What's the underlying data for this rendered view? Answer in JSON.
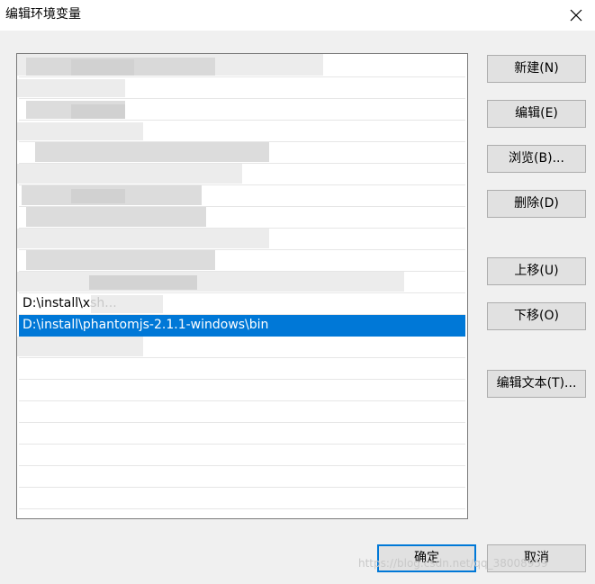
{
  "window": {
    "title": "编辑环境变量"
  },
  "list": {
    "items": [
      {
        "text": ""
      },
      {
        "text": ""
      },
      {
        "text": ""
      },
      {
        "text": ""
      },
      {
        "text": ""
      },
      {
        "text": ""
      },
      {
        "text": ""
      },
      {
        "text": ""
      },
      {
        "text": ""
      },
      {
        "text": ""
      },
      {
        "text": ""
      },
      {
        "text": "D:\\install\\xsh..."
      },
      {
        "text": "D:\\install\\phantomjs-2.1.1-windows\\bin"
      },
      {
        "text": ""
      }
    ],
    "selected_index": 12
  },
  "buttons": {
    "new": "新建(N)",
    "edit": "编辑(E)",
    "browse": "浏览(B)...",
    "delete": "删除(D)",
    "move_up": "上移(U)",
    "move_down": "下移(O)",
    "edit_text": "编辑文本(T)...",
    "ok": "确定",
    "cancel": "取消"
  },
  "watermark": "https://blog.csdn.net/qq_38008959"
}
